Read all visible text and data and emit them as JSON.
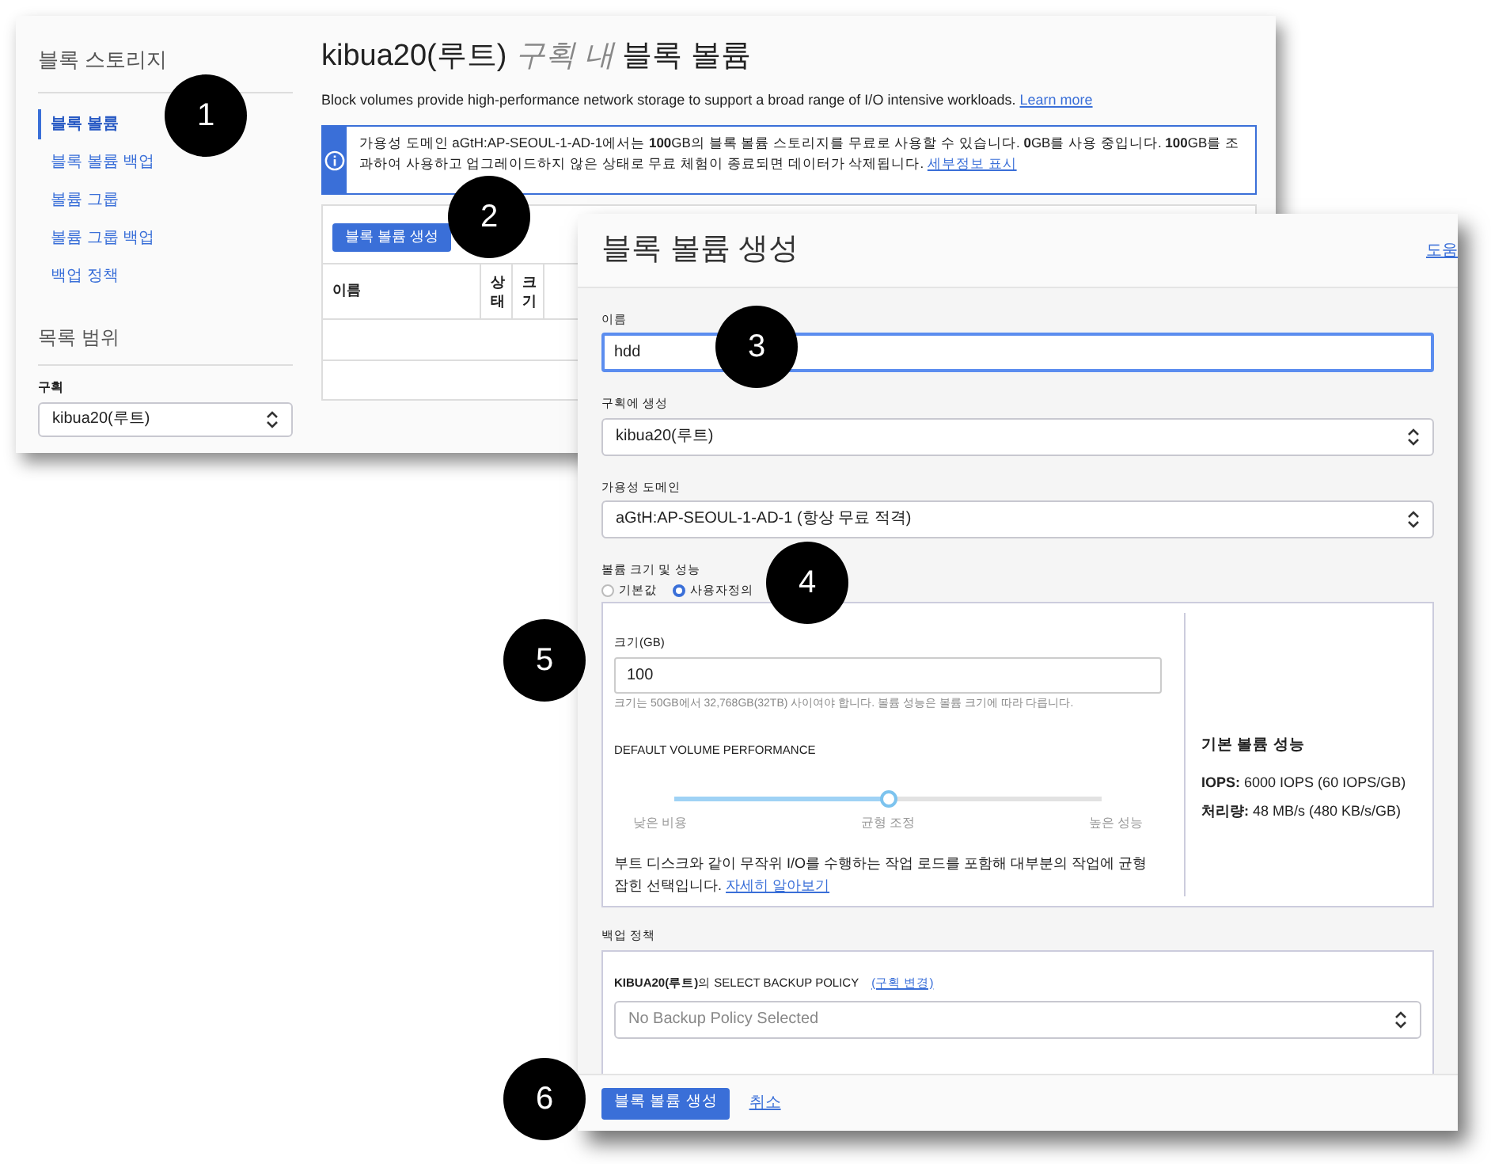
{
  "console": {
    "sidebar": {
      "title": "블록 스토리지",
      "items": [
        {
          "label": "블록 볼륨",
          "selected": true
        },
        {
          "label": "블록 볼륨 백업",
          "selected": false
        },
        {
          "label": "볼륨 그룹",
          "selected": false
        },
        {
          "label": "볼륨 그룹 백업",
          "selected": false
        },
        {
          "label": "백업 정책",
          "selected": false
        }
      ],
      "scope_title": "목록 범위",
      "compartment_label": "구획",
      "compartment_value": "kibua20(루트)"
    },
    "title": {
      "prefix": "kibua20(루트)",
      "italic": "구획 내",
      "suffix": "블록 볼륨"
    },
    "description": "Block volumes provide high-performance network storage to support a broad range of I/O intensive workloads.",
    "learn_more": "Learn more",
    "info_banner": {
      "text": "가용성 도메인 aGtH:AP-SEOUL-1-AD-1에서는 **100**GB의 블록 볼륨 스토리지를 무료로 사용할 수 있습니다. **0**GB를 사용 중입니다. **100**GB를 조과하여 사용하고 업그레이드하지 않은 상태로 무료 체험이 종료되면 데이터가 삭제됩니다.",
      "link": "세부정보 표시"
    },
    "create_button": "블록 볼륨 생성",
    "table": {
      "columns": [
        "이름",
        "상태",
        "크기"
      ]
    }
  },
  "dialog": {
    "title": "블록 볼륨 생성",
    "help_link": "도움",
    "name": {
      "label": "이름",
      "value": "hdd"
    },
    "compartment": {
      "label": "구획에 생성",
      "value": "kibua20(루트)"
    },
    "availability_domain": {
      "label": "가용성 도메인",
      "value": "aGtH:AP-SEOUL-1-AD-1 (항상 무료 적격)"
    },
    "performance": {
      "label": "볼륨 크기 및 성능",
      "options": [
        {
          "label": "기본값",
          "selected": false
        },
        {
          "label": "사용자정의",
          "selected": true
        }
      ],
      "size_label": "크기(GB)",
      "size_value": "100",
      "size_hint": "크기는 50GB에서 32,768GB(32TB) 사이여야 합니다. 볼륨 성능은 볼륨 크기에 따라 다릅니다.",
      "section_title": "DEFAULT VOLUME PERFORMANCE",
      "slider": {
        "level": 0.5,
        "stops": [
          "낮은 비용",
          "균형 조정",
          "높은 성능"
        ]
      },
      "note": "부트 디스크와 같이 무작위 I/O를 수행하는 작업 로드를 포함해 대부분의 작업에 균형 잡힌 선택입니다.",
      "note_link": "자세히 알아보기",
      "summary_title": "기본 볼륨 성능",
      "iops_label": "IOPS:",
      "iops_value": "6000 IOPS (60 IOPS/GB)",
      "throughput_label": "처리량:",
      "throughput_value": "48 MB/s (480 KB/s/GB)"
    },
    "backup": {
      "label": "백업 정책",
      "policy_caption": "**KIBUA20(루트)**의 SELECT BACKUP POLICY",
      "change_link": "(구획 변경)",
      "placeholder": "No Backup Policy Selected"
    },
    "submit": "블록 볼륨 생성",
    "cancel": "취소"
  },
  "callouts": [
    "1",
    "2",
    "3",
    "4",
    "5",
    "6"
  ]
}
